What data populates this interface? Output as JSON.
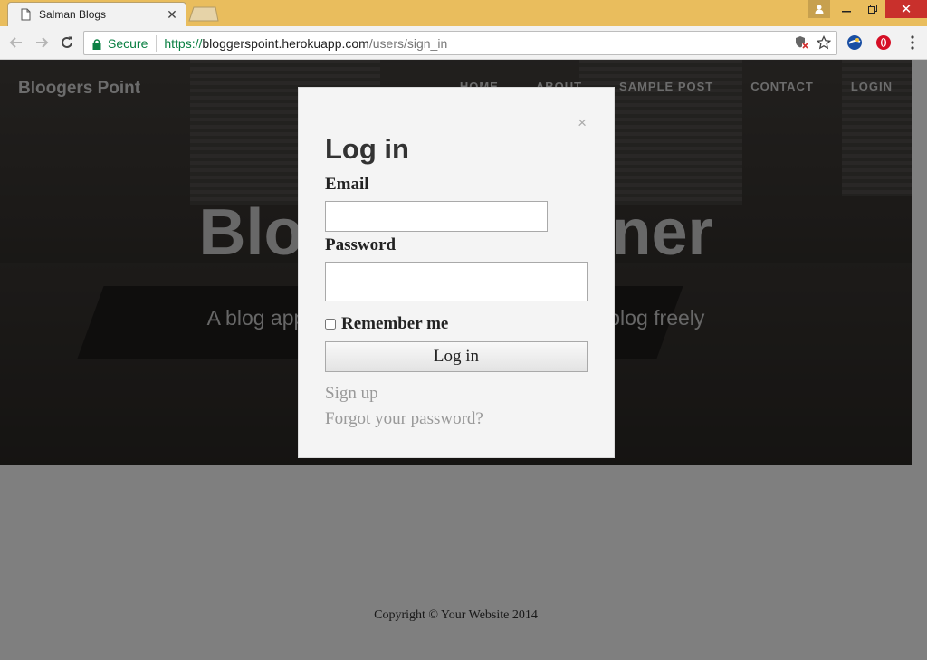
{
  "browser": {
    "tab_title": "Salman Blogs",
    "secure_label": "Secure",
    "url_scheme": "https://",
    "url_host": "bloggerspoint.herokuapp.com",
    "url_path": "/users/sign_in"
  },
  "site": {
    "brand": "Bloogers Point",
    "nav": [
      "HOME",
      "ABOUT",
      "SAMPLE POST",
      "CONTACT",
      "LOGIN"
    ],
    "hero_title": "Bloggers Corner",
    "hero_subtitle": "A blog application where you can post your blog freely",
    "footer": "Copyright © Your Website 2014"
  },
  "modal": {
    "close_glyph": "×",
    "title": "Log in",
    "email_label": "Email",
    "email_value": "",
    "password_label": "Password",
    "password_value": "",
    "remember_label": "Remember me",
    "submit_label": "Log in",
    "signup_link": "Sign up",
    "forgot_link": "Forgot your password?"
  },
  "colors": {
    "tabstrip": "#e9bd5d",
    "secure_green": "#0b8043",
    "close_red": "#c9302c"
  }
}
